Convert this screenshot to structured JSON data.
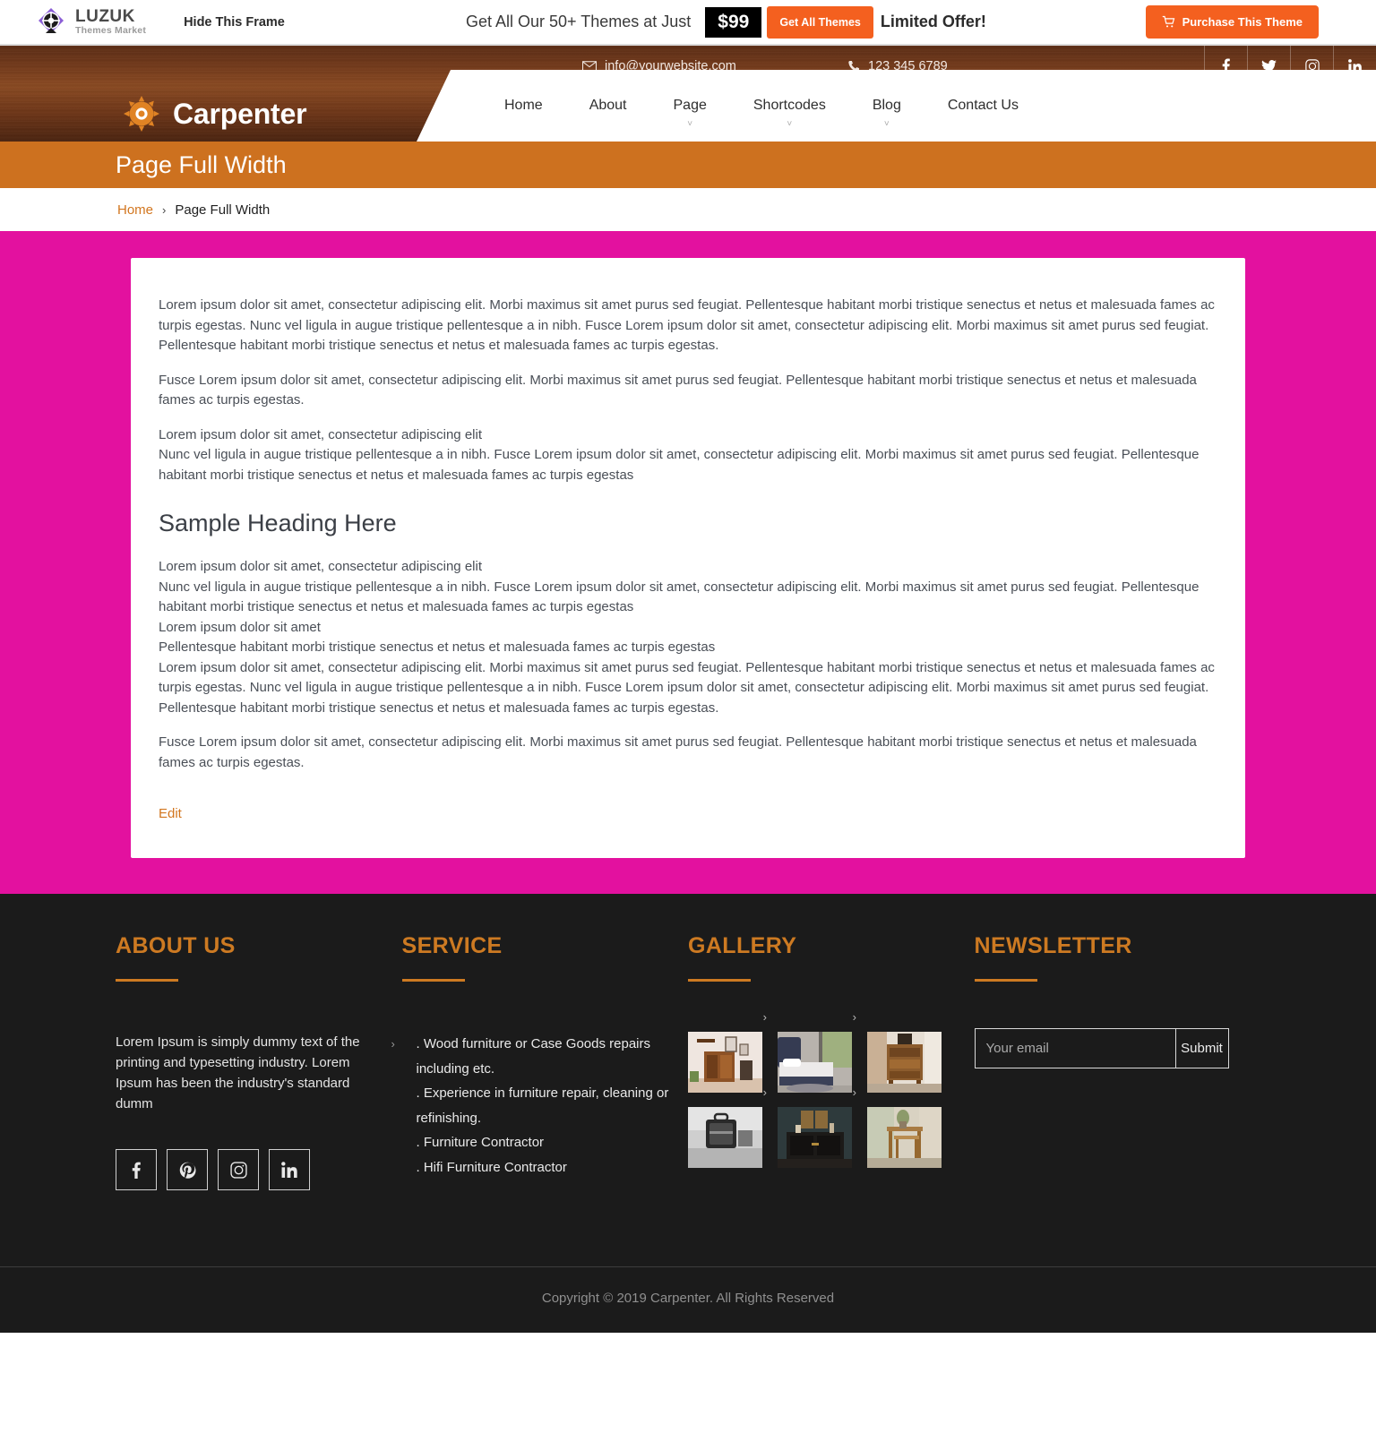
{
  "promo_bar": {
    "brand_name": "LUZUK",
    "brand_tagline": "Themes Market",
    "hide_frame_label": "Hide This Frame",
    "offer_text": "Get All Our 50+ Themes at Just",
    "price": "$99",
    "get_all_label": "Get All Themes",
    "limited_label": "Limited Offer!",
    "purchase_label": "Purchase This Theme",
    "accent_color": "#f4601f"
  },
  "header": {
    "email": "info@yourwebsite.com",
    "phone": "123 345 6789",
    "brand": "Carpenter",
    "social": [
      {
        "name": "facebook",
        "glyph": "f"
      },
      {
        "name": "twitter",
        "glyph": "t"
      },
      {
        "name": "instagram",
        "glyph": "i"
      },
      {
        "name": "linkedin",
        "glyph": "in"
      }
    ],
    "nav": [
      {
        "label": "Home",
        "has_dropdown": false
      },
      {
        "label": "About",
        "has_dropdown": false
      },
      {
        "label": "Page",
        "has_dropdown": true
      },
      {
        "label": "Shortcodes",
        "has_dropdown": true
      },
      {
        "label": "Blog",
        "has_dropdown": true
      },
      {
        "label": "Contact Us",
        "has_dropdown": false
      }
    ]
  },
  "page": {
    "title": "Page Full Width",
    "breadcrumb_home": "Home",
    "breadcrumb_sep": "›",
    "breadcrumb_current": "Page Full Width",
    "title_band_color": "#cd711f",
    "content_bg_color": "#e3119f"
  },
  "content": {
    "p1": "Lorem ipsum dolor sit amet, consectetur adipiscing elit. Morbi maximus sit amet purus sed feugiat. Pellentesque habitant morbi tristique senectus et netus et malesuada fames ac turpis egestas. Nunc vel ligula in augue tristique pellentesque a in nibh. Fusce Lorem ipsum dolor sit amet, consectetur adipiscing elit. Morbi maximus sit amet purus sed feugiat. Pellentesque habitant morbi tristique senectus et netus et malesuada fames ac turpis egestas.",
    "p2": "Fusce Lorem ipsum dolor sit amet, consectetur adipiscing elit. Morbi maximus sit amet purus sed feugiat. Pellentesque habitant morbi tristique senectus et netus et malesuada fames ac turpis egestas.",
    "p3a": "Lorem ipsum dolor sit amet, consectetur adipiscing elit",
    "p3b": "Nunc vel ligula in augue tristique pellentesque a in nibh. Fusce Lorem ipsum dolor sit amet, consectetur adipiscing elit. Morbi maximus sit amet purus sed feugiat. Pellentesque habitant morbi tristique senectus et netus et malesuada fames ac turpis egestas",
    "heading": "Sample Heading Here",
    "p4a": "Lorem ipsum dolor sit amet, consectetur adipiscing elit",
    "p4b": "Nunc vel ligula in augue tristique pellentesque a in nibh. Fusce Lorem ipsum dolor sit amet, consectetur adipiscing elit. Morbi maximus sit amet purus sed feugiat. Pellentesque habitant morbi tristique senectus et netus et malesuada fames ac turpis egestas",
    "p4c": "Lorem ipsum dolor sit amet",
    "p4d": "Pellentesque habitant morbi tristique senectus et netus et malesuada fames ac turpis egestas",
    "p4e": "Lorem ipsum dolor sit amet, consectetur adipiscing elit. Morbi maximus sit amet purus sed feugiat. Pellentesque habitant morbi tristique senectus et netus et malesuada fames ac turpis egestas. Nunc vel ligula in augue tristique pellentesque a in nibh. Fusce Lorem ipsum dolor sit amet, consectetur adipiscing elit. Morbi maximus sit amet purus sed feugiat. Pellentesque habitant morbi tristique senectus et netus et malesuada fames ac turpis egestas.",
    "p5": "Fusce Lorem ipsum dolor sit amet, consectetur adipiscing elit. Morbi maximus sit amet purus sed feugiat. Pellentesque habitant morbi tristique senectus et netus et malesuada fames ac turpis egestas.",
    "edit_label": "Edit"
  },
  "footer": {
    "about": {
      "heading": "ABOUT US",
      "text": "Lorem Ipsum is simply dummy text of the printing and typesetting industry. Lorem Ipsum has been the industry's standard dumm",
      "social": [
        {
          "name": "facebook",
          "glyph": "f"
        },
        {
          "name": "pinterest",
          "glyph": "p"
        },
        {
          "name": "instagram",
          "glyph": "i"
        },
        {
          "name": "linkedin",
          "glyph": "in"
        }
      ]
    },
    "service": {
      "heading": "SERVICE",
      "items": [
        ". Wood furniture or Case Goods repairs including etc.",
        ". Experience in furniture repair, cleaning or refinishing.",
        ". Furniture Contractor",
        ". Hifi Furniture Contractor"
      ]
    },
    "gallery": {
      "heading": "GALLERY",
      "items": [
        {
          "alt": "wine-cabinet-thumb"
        },
        {
          "alt": "bed-thumb"
        },
        {
          "alt": "wooden-dresser-thumb"
        },
        {
          "alt": "bw-suitcase-thumb"
        },
        {
          "alt": "dark-sideboard-thumb"
        },
        {
          "alt": "nesting-tables-thumb"
        }
      ]
    },
    "newsletter": {
      "heading": "NEWSLETTER",
      "placeholder": "Your email",
      "value": "",
      "submit_label": "Submit"
    },
    "copyright": "Copyright © 2019 Carpenter. All Rights Reserved",
    "accent_color": "#cd7a22"
  }
}
